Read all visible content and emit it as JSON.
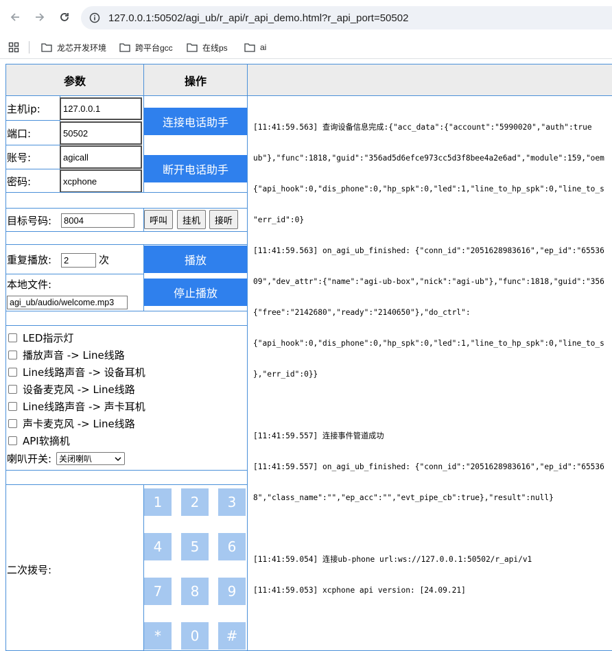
{
  "browser": {
    "url": "127.0.0.1:50502/agi_ub/r_api/r_api_demo.html?r_api_port=50502",
    "bookmarks": [
      "龙芯开发环境",
      "跨平台gcc",
      "在线ps",
      "ai"
    ]
  },
  "table": {
    "header_params": "参数",
    "header_ops": "操作"
  },
  "conn": {
    "host_label": "主机ip:",
    "host_value": "127.0.0.1",
    "port_label": "端口:",
    "port_value": "50502",
    "account_label": "账号:",
    "account_value": "agicall",
    "password_label": "密码:",
    "password_value": "xcphone",
    "connect_btn": "连接电话助手",
    "disconnect_btn": "断开电话助手"
  },
  "call": {
    "target_label": "目标号码:",
    "target_value": "8004",
    "dial_btn": "呼叫",
    "hangup_btn": "挂机",
    "answer_btn": "接听"
  },
  "play": {
    "repeat_label": "重复播放:",
    "repeat_value": "2",
    "repeat_unit": "次",
    "play_btn": "播放",
    "file_label": "本地文件:",
    "file_value": "agi_ub/audio/welcome.mp3",
    "stop_btn": "停止播放"
  },
  "options": {
    "items": [
      "LED指示灯",
      "播放声音 -> Line线路",
      "Line线路声音 -> 设备耳机",
      "设备麦克风 -> Line线路",
      "Line线路声音 -> 声卡耳机",
      "声卡麦克风 -> Line线路",
      "API软摘机"
    ],
    "speaker_label": "喇叭开关:",
    "speaker_value": "关闭喇叭"
  },
  "dtmf": {
    "label": "二次拨号:",
    "keys": [
      "1",
      "2",
      "3",
      "4",
      "5",
      "6",
      "7",
      "8",
      "9",
      "*",
      "0",
      "#"
    ]
  },
  "log": {
    "lines": [
      "[11:41:59.563] 查询设备信息完成:{\"acc_data\":{\"account\":\"5990020\",\"auth\":true",
      "ub\"},\"func\":1818,\"guid\":\"356ad5d6efce973cc5d3f8bee4a2e6ad\",\"module\":159,\"oem",
      "{\"api_hook\":0,\"dis_phone\":0,\"hp_spk\":0,\"led\":1,\"line_to_hp_spk\":0,\"line_to_s",
      "\"err_id\":0}",
      "[11:41:59.563] on_agi_ub_finished: {\"conn_id\":\"2051628983616\",\"ep_id\":\"65536",
      "09\",\"dev_attr\":{\"name\":\"agi-ub-box\",\"nick\":\"agi-ub\"},\"func\":1818,\"guid\":\"356",
      "{\"free\":\"2142680\",\"ready\":\"2140650\"},\"do_ctrl\":",
      "{\"api_hook\":0,\"dis_phone\":0,\"hp_spk\":0,\"led\":1,\"line_to_hp_spk\":0,\"line_to_s",
      "},\"err_id\":0}}",
      "",
      "[11:41:59.557] 连接事件管道成功",
      "[11:41:59.557] on_agi_ub_finished: {\"conn_id\":\"2051628983616\",\"ep_id\":\"65536",
      "8\",\"class_name\":\"\",\"ep_acc\":\"\",\"evt_pipe_cb\":true},\"result\":null}",
      "",
      "[11:41:59.054] 连接ub-phone url:ws://127.0.0.1:50502/r_api/v1",
      "[11:41:59.053] xcphone api version: [24.09.21]"
    ]
  },
  "colors": {
    "accent": "#2f80ed",
    "border": "#4a90d9",
    "keypad": "#a6c8f0",
    "header_bg": "#ececec"
  }
}
